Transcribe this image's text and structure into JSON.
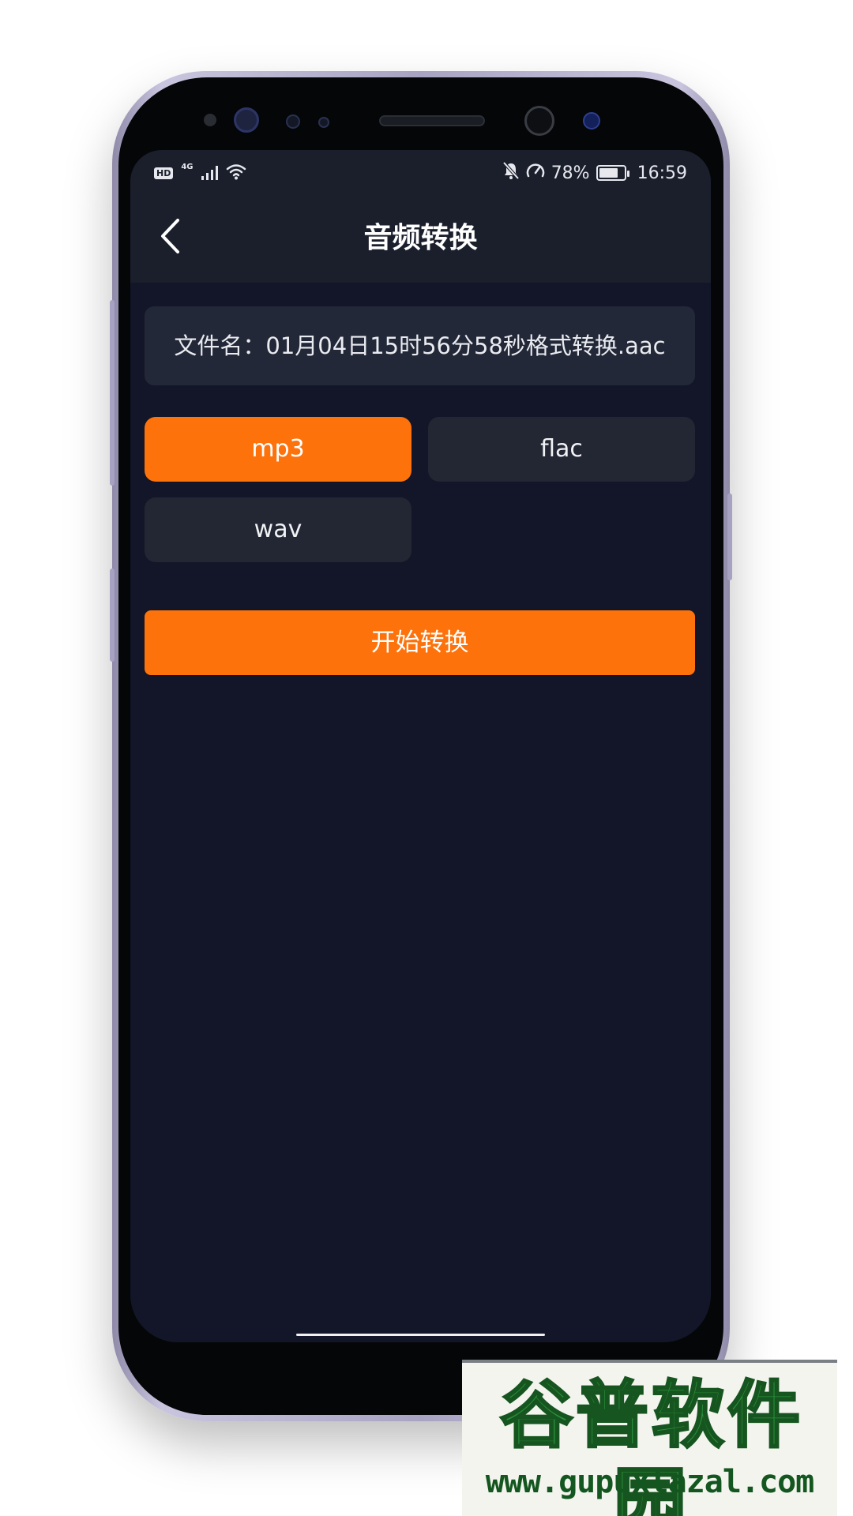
{
  "status_bar": {
    "hd": "HD",
    "network": "4G",
    "battery": "78%",
    "battery_level": 0.78,
    "time": "16:59"
  },
  "header": {
    "title": "音频转换"
  },
  "file": {
    "label": "文件名：",
    "name": "01月04日15时56分58秒格式转换.aac"
  },
  "formats": {
    "options": [
      {
        "label": "mp3",
        "selected": true
      },
      {
        "label": "flac",
        "selected": false
      },
      {
        "label": "wav",
        "selected": false
      }
    ]
  },
  "actions": {
    "start_label": "开始转换"
  },
  "watermark": {
    "logo_text": "谷普软件园",
    "url": "www.gupuxlazal.com"
  },
  "colors": {
    "accent": "#fd720b",
    "background": "#121628",
    "header": "#1b1f2c"
  }
}
